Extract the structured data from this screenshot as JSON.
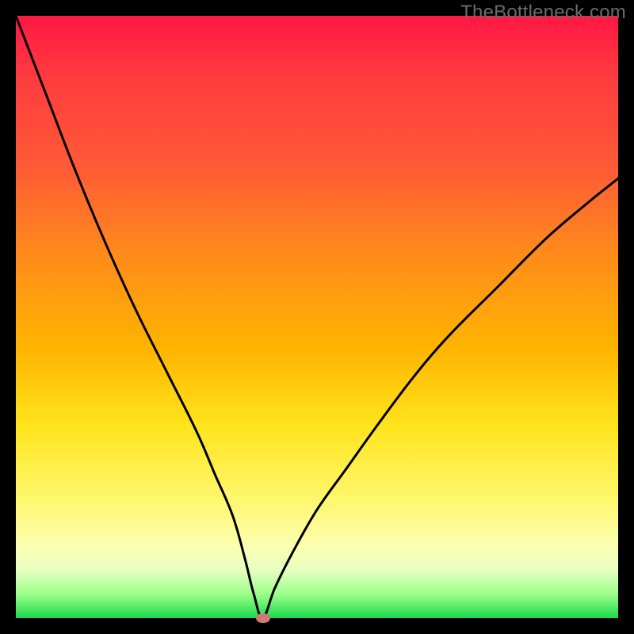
{
  "watermark": "TheBottleneck.com",
  "colors": {
    "frame": "#000000",
    "gradient_top": "#ff1744",
    "gradient_mid": "#ffe41c",
    "gradient_bottom": "#1bd94c",
    "curve": "#000000",
    "marker": "#cf7a72"
  },
  "chart_data": {
    "type": "line",
    "title": "",
    "xlabel": "",
    "ylabel": "",
    "xlim": [
      0,
      100
    ],
    "ylim": [
      0,
      100
    ],
    "grid": false,
    "legend": null,
    "minimum_marker": {
      "x": 41,
      "y": 0
    },
    "series": [
      {
        "name": "bottleneck-curve",
        "x": [
          0,
          5,
          10,
          15,
          20,
          25,
          30,
          33,
          36,
          38,
          39.5,
          41,
          43,
          46,
          50,
          55,
          60,
          66,
          72,
          80,
          88,
          95,
          100
        ],
        "y": [
          100,
          87,
          74,
          62,
          51,
          41,
          31,
          24,
          17,
          10,
          4,
          0,
          5,
          11,
          18,
          25,
          32,
          40,
          47,
          55,
          63,
          69,
          73
        ]
      }
    ],
    "background_gradient_stops": [
      {
        "pct": 0,
        "color": "#ff1744"
      },
      {
        "pct": 25,
        "color": "#ff5a36"
      },
      {
        "pct": 55,
        "color": "#ffb300"
      },
      {
        "pct": 80,
        "color": "#fff76b"
      },
      {
        "pct": 96,
        "color": "#9cff8a"
      },
      {
        "pct": 100,
        "color": "#1bd94c"
      }
    ]
  }
}
